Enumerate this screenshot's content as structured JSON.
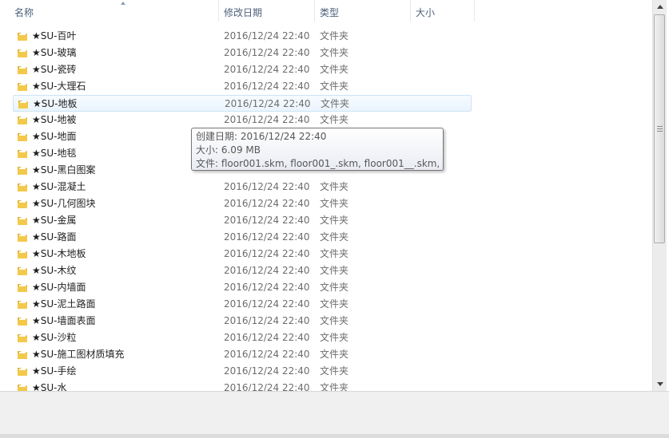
{
  "header": {
    "columns": [
      {
        "label": "名称"
      },
      {
        "label": "修改日期"
      },
      {
        "label": "类型"
      },
      {
        "label": "大小"
      }
    ]
  },
  "files": [
    {
      "name": "★SU-百叶",
      "date": "2016/12/24 22:40",
      "type": "文件夹"
    },
    {
      "name": "★SU-玻璃",
      "date": "2016/12/24 22:40",
      "type": "文件夹"
    },
    {
      "name": "★SU-瓷砖",
      "date": "2016/12/24 22:40",
      "type": "文件夹"
    },
    {
      "name": "★SU-大理石",
      "date": "2016/12/24 22:40",
      "type": "文件夹"
    },
    {
      "name": "★SU-地板",
      "date": "2016/12/24 22:40",
      "type": "文件夹",
      "selected": true
    },
    {
      "name": "★SU-地被",
      "date": "2016/12/24 22:40",
      "type": "文件夹"
    },
    {
      "name": "★SU-地面",
      "date": "",
      "type": ""
    },
    {
      "name": "★SU-地毯",
      "date": "",
      "type": ""
    },
    {
      "name": "★SU-黑白图案",
      "date": "",
      "type": ""
    },
    {
      "name": "★SU-混凝土",
      "date": "2016/12/24 22:40",
      "type": "文件夹"
    },
    {
      "name": "★SU-几何图块",
      "date": "2016/12/24 22:40",
      "type": "文件夹"
    },
    {
      "name": "★SU-金属",
      "date": "2016/12/24 22:40",
      "type": "文件夹"
    },
    {
      "name": "★SU-路面",
      "date": "2016/12/24 22:40",
      "type": "文件夹"
    },
    {
      "name": "★SU-木地板",
      "date": "2016/12/24 22:40",
      "type": "文件夹"
    },
    {
      "name": "★SU-木纹",
      "date": "2016/12/24 22:40",
      "type": "文件夹"
    },
    {
      "name": "★SU-内墙面",
      "date": "2016/12/24 22:40",
      "type": "文件夹"
    },
    {
      "name": "★SU-泥土路面",
      "date": "2016/12/24 22:40",
      "type": "文件夹"
    },
    {
      "name": "★SU-墙面表面",
      "date": "2016/12/24 22:40",
      "type": "文件夹"
    },
    {
      "name": "★SU-沙粒",
      "date": "2016/12/24 22:40",
      "type": "文件夹"
    },
    {
      "name": "★SU-施工图材质填充",
      "date": "2016/12/24 22:40",
      "type": "文件夹"
    },
    {
      "name": "★SU-手绘",
      "date": "2016/12/24 22:40",
      "type": "文件夹"
    },
    {
      "name": "★SU-水",
      "date": "2016/12/24 22:40",
      "type": "文件夹"
    }
  ],
  "tooltip": {
    "created": "创建日期: 2016/12/24 22:40",
    "size": "大小: 6.09 MB",
    "files": "文件: floor001.skm, floor001_.skm, floor001__.skm, ..."
  },
  "colors": {
    "folder": "#f3c94b",
    "selection": "#cde4f7",
    "header_text": "#4c607a"
  },
  "icons": {
    "folder": "folder-icon",
    "sort": "sort-ascending-icon"
  }
}
